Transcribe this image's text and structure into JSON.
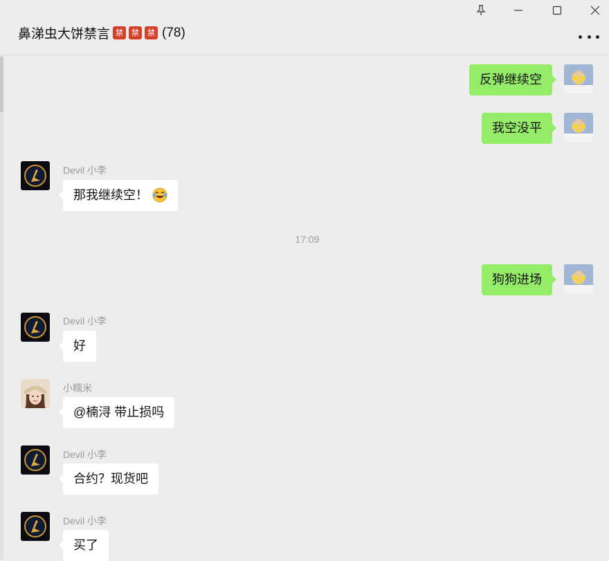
{
  "window": {
    "title": "鼻涕虫大饼禁言",
    "ban_glyph": "禁",
    "member_count": "(78)",
    "controls": [
      "pin-icon",
      "minimize-icon",
      "maximize-icon",
      "close-icon"
    ],
    "more_icon": "more-icon"
  },
  "colors": {
    "background": "#ededed",
    "outgoing_bubble": "#95ec69",
    "incoming_bubble": "#ffffff",
    "ban_badge": "#d6402b",
    "sender_text": "#9a9a9a"
  },
  "messages": [
    {
      "direction": "out",
      "text": "反弹继续空"
    },
    {
      "direction": "out",
      "text": "我空没平"
    },
    {
      "direction": "in",
      "sender": "Devil 小李",
      "text": "那我继续空！",
      "emoji": "laughing-tears-emoji"
    },
    {
      "type": "time",
      "text": "17:09"
    },
    {
      "direction": "out",
      "text": "狗狗进场"
    },
    {
      "direction": "in",
      "sender": "Devil 小李",
      "text": "好"
    },
    {
      "direction": "in",
      "sender": "小糯米",
      "text": "@楠浔 带止损吗"
    },
    {
      "direction": "in",
      "sender": "Devil 小李",
      "text": "合约？现货吧"
    },
    {
      "direction": "in",
      "sender": "Devil 小李",
      "text": "买了"
    }
  ]
}
